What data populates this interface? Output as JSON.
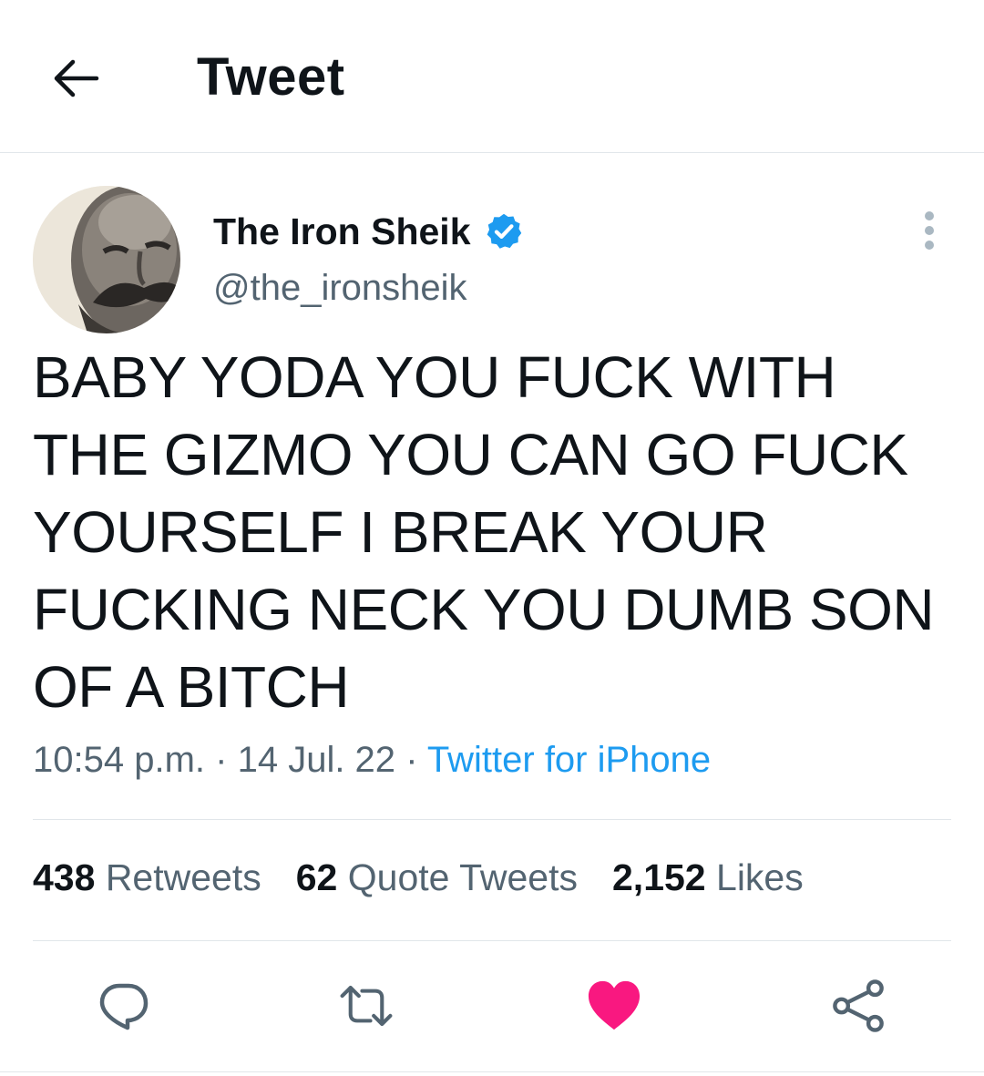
{
  "header": {
    "title": "Tweet"
  },
  "author": {
    "display_name": "The Iron Sheik",
    "handle": "@the_ironsheik",
    "verified": true
  },
  "tweet": {
    "text": "BABY YODA YOU FUCK WITH THE GIZMO YOU CAN GO FUCK YOURSELF I BREAK YOUR FUCKING NECK YOU DUMB SON OF A BITCH",
    "time": "10:54 p.m.",
    "separator": "·",
    "date": "14 Jul. 22",
    "source": "Twitter for iPhone"
  },
  "stats": {
    "retweets_count": "438",
    "retweets_label": "Retweets",
    "quotes_count": "62",
    "quotes_label": "Quote Tweets",
    "likes_count": "2,152",
    "likes_label": "Likes"
  },
  "actions": {
    "liked": true
  },
  "colors": {
    "text": "#0f1419",
    "secondary": "#536471",
    "accent": "#1d9bf0",
    "like": "#f91880",
    "divider": "#e1e6ea"
  },
  "icons": [
    "back-arrow-icon",
    "verified-badge-icon",
    "more-options-icon",
    "reply-icon",
    "retweet-icon",
    "like-heart-icon",
    "share-icon"
  ]
}
